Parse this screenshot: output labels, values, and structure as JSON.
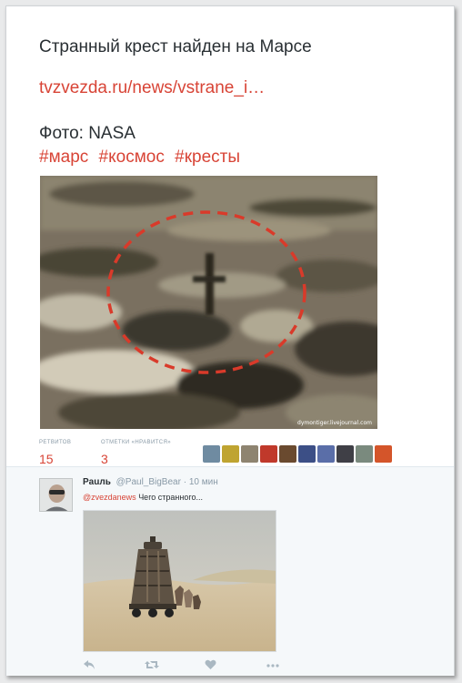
{
  "tweet": {
    "text": "Странный крест найден на Марсе",
    "link": "tvzvezda.ru/news/vstrane_i…",
    "photo_caption": "Фото: NASA",
    "hashtags": [
      "#марс",
      "#космос",
      "#кресты"
    ],
    "photo_watermark": "dymontiger.livejournal.com"
  },
  "stats": {
    "retweets_label": "РЕТВИТОВ",
    "retweets_count": "15",
    "likes_label": "ОТМЕТКИ «НРАВИТСЯ»",
    "likes_count": "3",
    "liker_avatar_colors": [
      "#6f8ba1",
      "#bfa431",
      "#8e8470",
      "#c0392b",
      "#6a4a2f",
      "#3c4f86",
      "#5a6ea8",
      "#3f3f46",
      "#7a8a7e",
      "#d4552a"
    ]
  },
  "reply": {
    "name": "Pauль",
    "handle": "@Paul_BigBear",
    "time": "· 10 мин",
    "mention": "@zvezdanews",
    "text": "Чего странного..."
  },
  "colors": {
    "accent": "#d84436",
    "muted": "#8899a6",
    "text": "#292f33",
    "reply_bg": "#f5f8fa"
  },
  "icons": [
    "reply-icon",
    "retweet-icon",
    "like-icon",
    "more-icon"
  ]
}
